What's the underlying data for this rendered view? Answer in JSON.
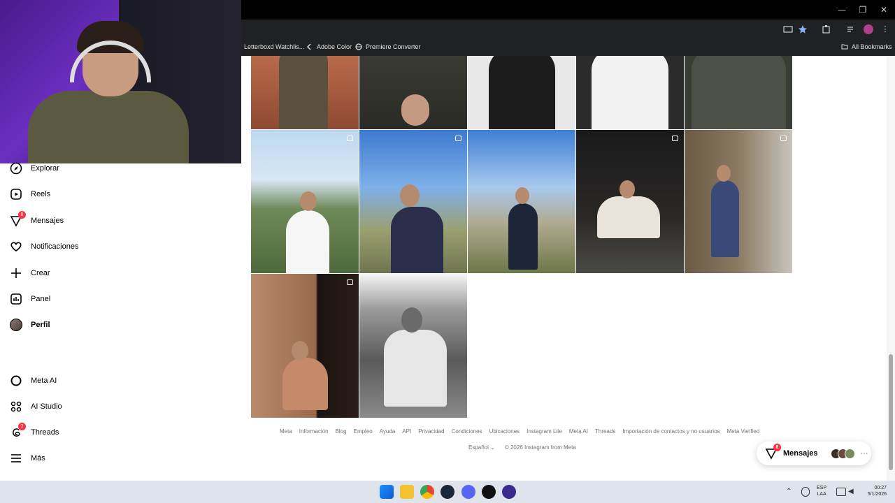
{
  "browser": {
    "bookmarks": [
      {
        "label": "Letterboxd Watchlis...",
        "icon": "letterboxd-icon"
      },
      {
        "label": "Adobe Color",
        "icon": "adobe-color-icon"
      },
      {
        "label": "Premiere Converter",
        "icon": "globe-icon"
      }
    ],
    "all_bookmarks": "All Bookmarks"
  },
  "sidebar": {
    "items": [
      {
        "label": "Explorar",
        "icon": "compass-icon"
      },
      {
        "label": "Reels",
        "icon": "reels-icon"
      },
      {
        "label": "Mensajes",
        "icon": "messenger-icon",
        "badge": "8"
      },
      {
        "label": "Notificaciones",
        "icon": "heart-icon"
      },
      {
        "label": "Crear",
        "icon": "plus-icon"
      },
      {
        "label": "Panel",
        "icon": "chart-icon"
      },
      {
        "label": "Perfil",
        "icon": "avatar"
      },
      {
        "label": "Meta AI",
        "icon": "meta-ai-icon"
      },
      {
        "label": "AI Studio",
        "icon": "ai-studio-icon"
      },
      {
        "label": "Threads",
        "icon": "threads-icon",
        "badge": "3"
      },
      {
        "label": "Más",
        "icon": "menu-icon"
      }
    ]
  },
  "footer": {
    "links": [
      "Meta",
      "Información",
      "Blog",
      "Empleo",
      "Ayuda",
      "API",
      "Privacidad",
      "Condiciones",
      "Ubicaciones",
      "Instagram Lite",
      "Meta AI",
      "Threads",
      "Importación de contactos y no usuarios",
      "Meta Verified"
    ],
    "language": "Español",
    "copyright": "© 2026 Instagram from Meta"
  },
  "messages_pill": {
    "label": "Mensajes",
    "badge": "8"
  },
  "taskbar": {
    "lang_line1": "ESP",
    "lang_line2": "LAA",
    "time": "00:27",
    "date": "5/1/2026"
  },
  "colors": {
    "accent": "#0095f6",
    "badge": "#ff3040",
    "chrome_dark": "#202124"
  }
}
